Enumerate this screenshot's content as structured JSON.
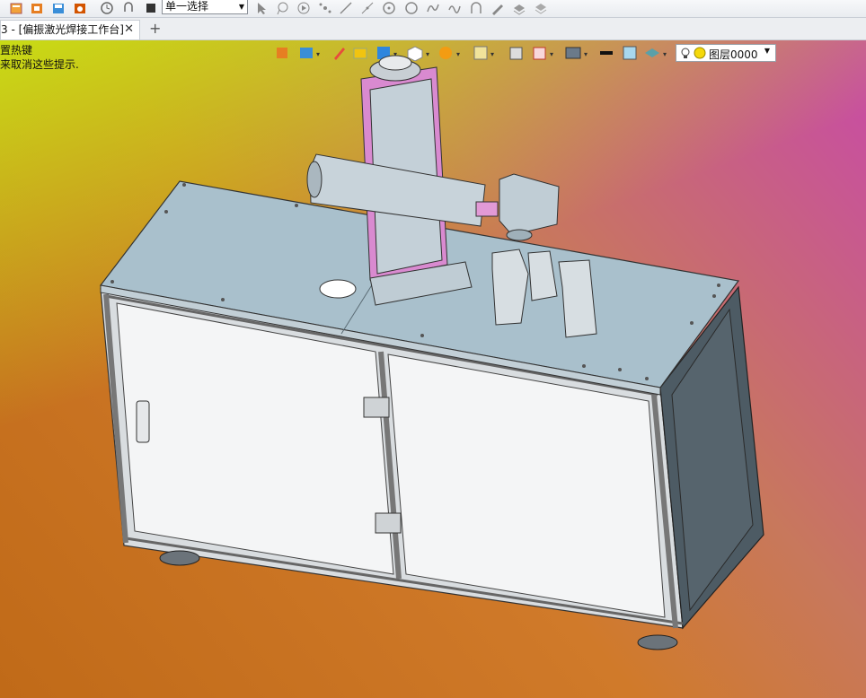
{
  "toolbar": {
    "selection_mode": "单一选择"
  },
  "tabs": {
    "active_label": "3 - [偏振激光焊接工作台]",
    "close_glyph": "✕",
    "add_glyph": "+"
  },
  "viewport": {
    "hint_line1": "置热键",
    "hint_line2": "来取消这些提示."
  },
  "view_toolbar": {
    "layer_label": "图层0000"
  },
  "icons": [
    "file-icon",
    "open-icon",
    "save-icon",
    "export-icon",
    "rotate-icon",
    "undo-icon",
    "stop-icon",
    "pointer-icon",
    "lasso-icon",
    "play-icon",
    "node-icon",
    "line-icon",
    "polyline-icon",
    "circle-icon",
    "polygon-icon",
    "curve-icon",
    "wave-icon",
    "arc-icon",
    "pen-icon",
    "layers-icon",
    "stack-icon"
  ],
  "colors": {
    "accent_top_left": "#c8e114",
    "accent_top_right": "#c84aa8",
    "accent_bottom": "#c06a18",
    "machine_panel": "#f4f5f6",
    "machine_top": "#a9c0cc",
    "laser_magenta": "#d98ad0"
  }
}
